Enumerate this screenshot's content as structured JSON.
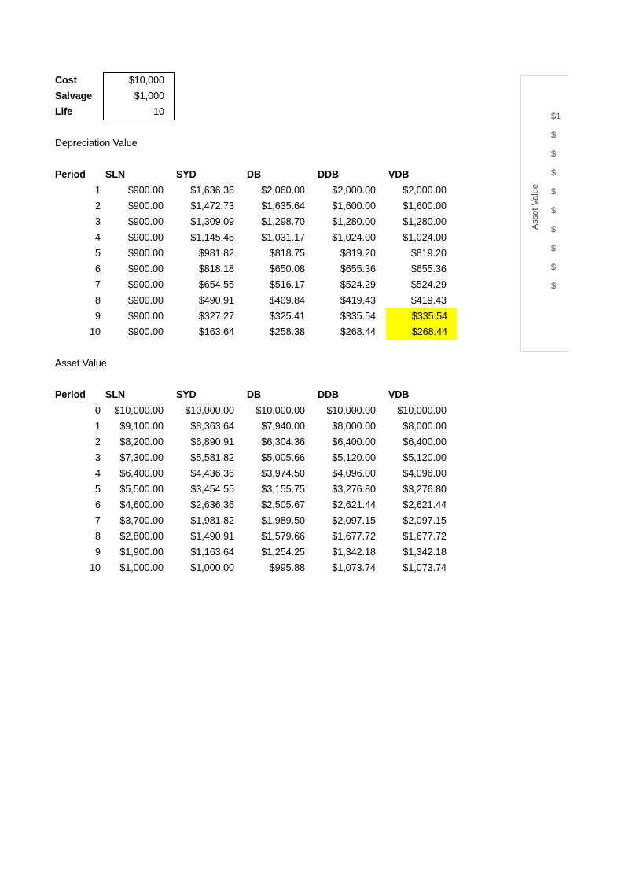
{
  "inputs": [
    {
      "label": "Cost",
      "value": "$10,000"
    },
    {
      "label": "Salvage",
      "value": "$1,000"
    },
    {
      "label": "Life",
      "value": "10"
    }
  ],
  "depreciation": {
    "title": "Depreciation Value",
    "headers": [
      "Period",
      "SLN",
      "SYD",
      "DB",
      "DDB",
      "VDB"
    ],
    "rows": [
      [
        "1",
        "$900.00",
        "$1,636.36",
        "$2,060.00",
        "$2,000.00",
        "$2,000.00"
      ],
      [
        "2",
        "$900.00",
        "$1,472.73",
        "$1,635.64",
        "$1,600.00",
        "$1,600.00"
      ],
      [
        "3",
        "$900.00",
        "$1,309.09",
        "$1,298.70",
        "$1,280.00",
        "$1,280.00"
      ],
      [
        "4",
        "$900.00",
        "$1,145.45",
        "$1,031.17",
        "$1,024.00",
        "$1,024.00"
      ],
      [
        "5",
        "$900.00",
        "$981.82",
        "$818.75",
        "$819.20",
        "$819.20"
      ],
      [
        "6",
        "$900.00",
        "$818.18",
        "$650.08",
        "$655.36",
        "$655.36"
      ],
      [
        "7",
        "$900.00",
        "$654.55",
        "$516.17",
        "$524.29",
        "$524.29"
      ],
      [
        "8",
        "$900.00",
        "$490.91",
        "$409.84",
        "$419.43",
        "$419.43"
      ],
      [
        "9",
        "$900.00",
        "$327.27",
        "$325.41",
        "$335.54",
        "$335.54"
      ],
      [
        "10",
        "$900.00",
        "$163.64",
        "$258.38",
        "$268.44",
        "$268.44"
      ]
    ],
    "highlight_color": "#ffff00"
  },
  "asset": {
    "title": "Asset Value",
    "headers": [
      "Period",
      "SLN",
      "SYD",
      "DB",
      "DDB",
      "VDB"
    ],
    "rows": [
      [
        "0",
        "$10,000.00",
        "$10,000.00",
        "$10,000.00",
        "$10,000.00",
        "$10,000.00"
      ],
      [
        "1",
        "$9,100.00",
        "$8,363.64",
        "$7,940.00",
        "$8,000.00",
        "$8,000.00"
      ],
      [
        "2",
        "$8,200.00",
        "$6,890.91",
        "$6,304.36",
        "$6,400.00",
        "$6,400.00"
      ],
      [
        "3",
        "$7,300.00",
        "$5,581.82",
        "$5,005.66",
        "$5,120.00",
        "$5,120.00"
      ],
      [
        "4",
        "$6,400.00",
        "$4,436.36",
        "$3,974.50",
        "$4,096.00",
        "$4,096.00"
      ],
      [
        "5",
        "$5,500.00",
        "$3,454.55",
        "$3,155.75",
        "$3,276.80",
        "$3,276.80"
      ],
      [
        "6",
        "$4,600.00",
        "$2,636.36",
        "$2,505.67",
        "$2,621.44",
        "$2,621.44"
      ],
      [
        "7",
        "$3,700.00",
        "$1,981.82",
        "$1,989.50",
        "$2,097.15",
        "$2,097.15"
      ],
      [
        "8",
        "$2,800.00",
        "$1,490.91",
        "$1,579.66",
        "$1,677.72",
        "$1,677.72"
      ],
      [
        "9",
        "$1,900.00",
        "$1,163.64",
        "$1,254.25",
        "$1,342.18",
        "$1,342.18"
      ],
      [
        "10",
        "$1,000.00",
        "$1,000.00",
        "$995.88",
        "$1,073.74",
        "$1,073.74"
      ]
    ]
  },
  "chart": {
    "y_axis_label": "Asset Value",
    "visible_tick_fragments": [
      "$1",
      "$",
      "$",
      "$",
      "$",
      "$",
      "$",
      "$",
      "$",
      "$"
    ]
  }
}
